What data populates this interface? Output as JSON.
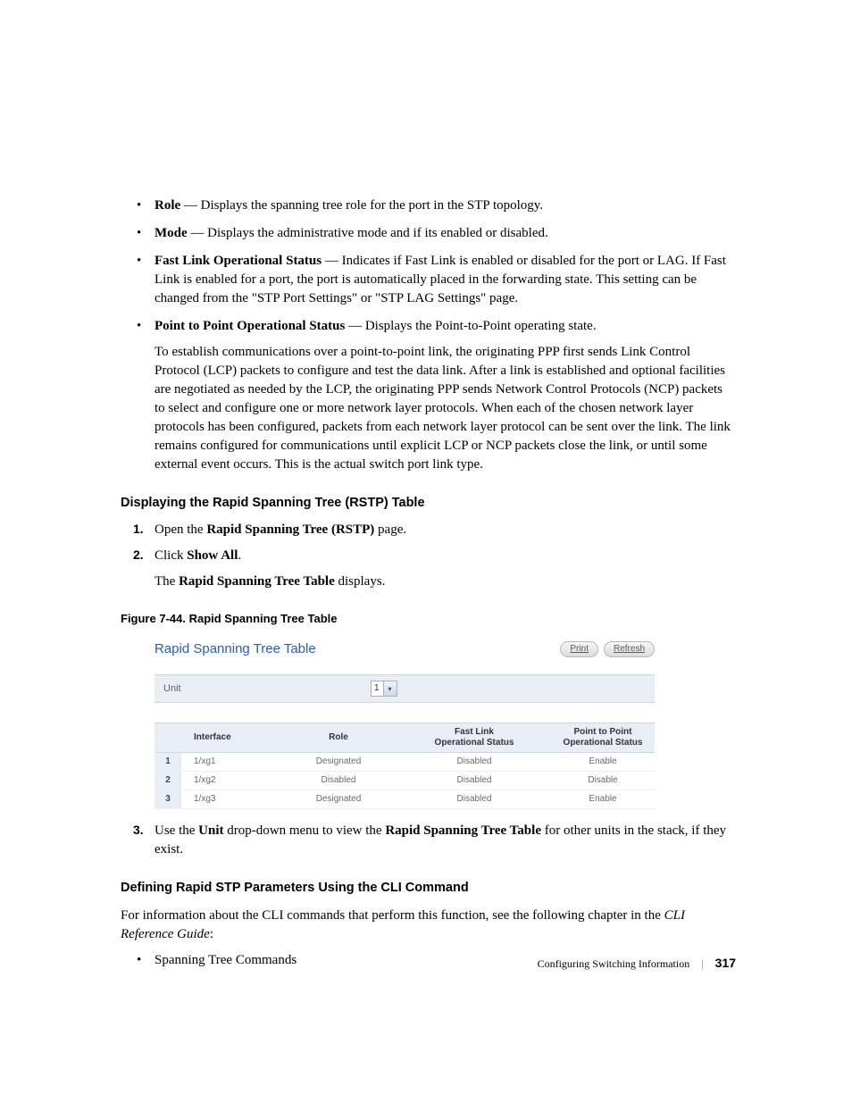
{
  "bullets": [
    {
      "term": "Role",
      "desc": " — Displays the spanning tree role for the port in the STP topology."
    },
    {
      "term": "Mode",
      "desc": " — Displays the administrative mode and if its enabled or disabled."
    },
    {
      "term": "Fast Link Operational Status",
      "desc": " — Indicates if Fast Link is enabled or disabled for the port or LAG. If Fast Link is enabled for a port, the port is automatically placed in the forwarding state. This setting can be changed from the \"STP Port Settings\" or \"STP LAG Settings\" page."
    },
    {
      "term": "Point to Point Operational Status",
      "desc": " — Displays the Point-to-Point operating state.",
      "extra": "To establish communications over a point-to-point link, the originating PPP first sends Link Control Protocol (LCP) packets to configure and test the data link. After a link is established and optional facilities are negotiated as needed by the LCP, the originating PPP sends Network Control Protocols (NCP) packets to select and configure one or more network layer protocols. When each of the chosen network layer protocols has been configured, packets from each network layer protocol can be sent over the link. The link remains configured for communications until explicit LCP or NCP packets close the link, or until some external event occurs. This is the actual switch port link type."
    }
  ],
  "section1_heading": "Displaying the Rapid Spanning Tree (RSTP) Table",
  "steps1": [
    {
      "pre": "Open the ",
      "bold": "Rapid Spanning Tree (RSTP)",
      "post": " page."
    },
    {
      "pre": "Click ",
      "bold": "Show All",
      "post": "."
    }
  ],
  "step1_followup_pre": "The ",
  "step1_followup_bold": "Rapid Spanning Tree Table",
  "step1_followup_post": " displays.",
  "figure_caption": "Figure 7-44.    Rapid Spanning Tree Table",
  "fig": {
    "title": "Rapid Spanning Tree Table",
    "btn_print": "Print",
    "btn_refresh": "Refresh",
    "unit_label": "Unit",
    "unit_value": "1",
    "headers": {
      "c0": "",
      "c1": "Interface",
      "c2": "Role",
      "c3_l1": "Fast Link",
      "c3_l2": "Operational Status",
      "c4_l1": "Point to Point",
      "c4_l2": "Operational Status"
    },
    "rows": [
      {
        "n": "1",
        "iface": "1/xg1",
        "role": "Designated",
        "fl": "Disabled",
        "pp": "Enable"
      },
      {
        "n": "2",
        "iface": "1/xg2",
        "role": "Disabled",
        "fl": "Disabled",
        "pp": "Disable"
      },
      {
        "n": "3",
        "iface": "1/xg3",
        "role": "Designated",
        "fl": "Disabled",
        "pp": "Enable"
      }
    ]
  },
  "step3_pre": "Use the ",
  "step3_b1": "Unit",
  "step3_mid": " drop-down menu to view the ",
  "step3_b2": "Rapid Spanning Tree Table",
  "step3_post": " for other units in the stack, if they exist.",
  "section2_heading": "Defining Rapid STP Parameters Using the CLI Command",
  "section2_p_pre": "For information about the CLI commands that perform this function, see the following chapter in the ",
  "section2_p_it": "CLI Reference Guide",
  "section2_p_post": ":",
  "bullets2": [
    "Spanning Tree Commands"
  ],
  "footer_text": "Configuring Switching Information",
  "page_number": "317"
}
